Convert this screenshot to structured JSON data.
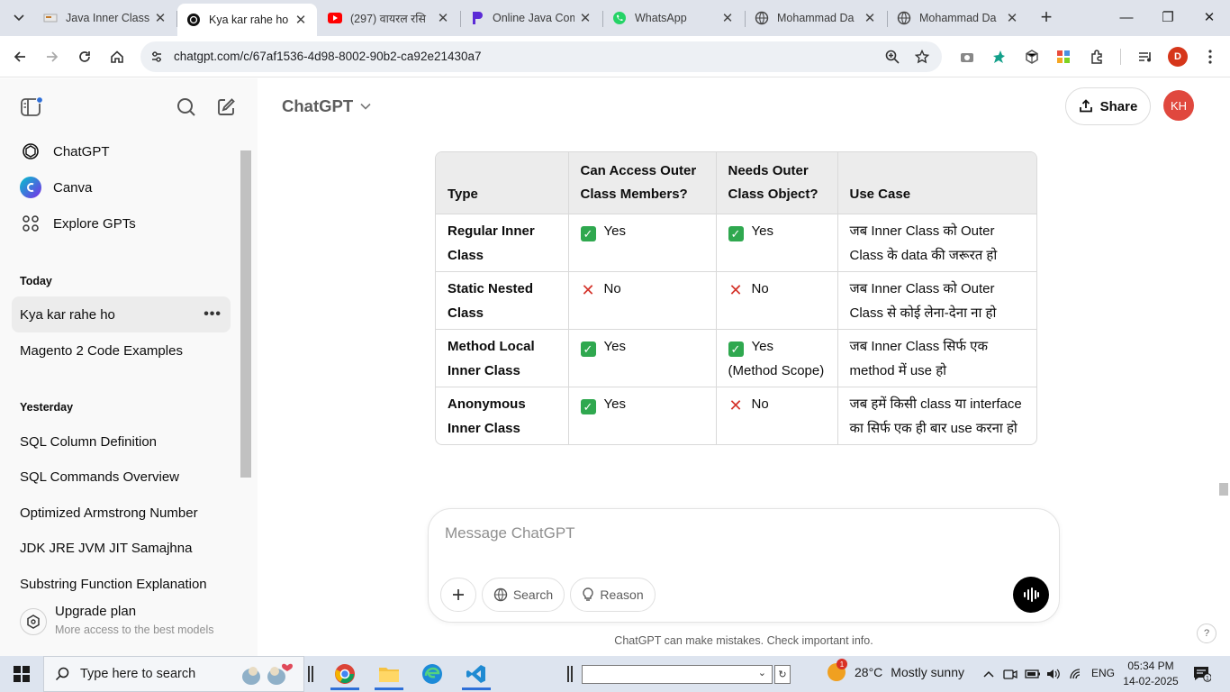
{
  "browser": {
    "tabs": [
      {
        "title": "Java Inner Class |",
        "favicon": "article-icon"
      },
      {
        "title": "Kya kar rahe ho",
        "favicon": "chatgpt-icon",
        "active": true
      },
      {
        "title": "(297) वायरल रसि",
        "favicon": "youtube-icon"
      },
      {
        "title": "Online Java Com",
        "favicon": "compiler-icon"
      },
      {
        "title": "WhatsApp",
        "favicon": "whatsapp-icon"
      },
      {
        "title": "Mohammad Da",
        "favicon": "globe-icon"
      },
      {
        "title": "Mohammad Da",
        "favicon": "globe-icon"
      }
    ],
    "url": "chatgpt.com/c/67af1536-4d98-8002-90b2-ca92e21430a7",
    "profile_initial": "D"
  },
  "sidebar": {
    "top_items": [
      {
        "label": "ChatGPT",
        "icon": "chatgpt-logo-icon"
      },
      {
        "label": "Canva",
        "icon": "canva-icon"
      },
      {
        "label": "Explore GPTs",
        "icon": "grid-icon"
      }
    ],
    "sections": [
      {
        "heading": "Today",
        "items": [
          "Kya kar rahe ho",
          "Magento 2 Code Examples"
        ]
      },
      {
        "heading": "Yesterday",
        "items": [
          "SQL Column Definition",
          "SQL Commands Overview",
          "Optimized Armstrong Number",
          "JDK JRE JVM JIT Samajhna",
          "Substring Function Explanation"
        ]
      }
    ],
    "more_label": "•••",
    "upgrade": {
      "title": "Upgrade plan",
      "subtitle": "More access to the best models"
    }
  },
  "header": {
    "model": "ChatGPT",
    "share_label": "Share",
    "avatar_initials": "KH"
  },
  "table": {
    "headers": [
      "Type",
      "Can Access Outer Class Members?",
      "Needs Outer Class Object?",
      "Use Case"
    ],
    "rows": [
      {
        "type": "Regular Inner Class",
        "access": {
          "mark": "✓",
          "text": "Yes"
        },
        "needs": {
          "mark": "✓",
          "text": "Yes"
        },
        "use_case": "जब Inner Class को Outer Class के data की जरूरत हो"
      },
      {
        "type": "Static Nested Class",
        "access": {
          "mark": "✕",
          "text": "No"
        },
        "needs": {
          "mark": "✕",
          "text": "No"
        },
        "use_case": "जब Inner Class को Outer Class से कोई लेना-देना ना हो"
      },
      {
        "type": "Method Local Inner Class",
        "access": {
          "mark": "✓",
          "text": "Yes"
        },
        "needs": {
          "mark": "✓",
          "text": "Yes (Method Scope)"
        },
        "use_case": "जब Inner Class सिर्फ एक method में use हो"
      },
      {
        "type": "Anonymous Inner Class",
        "access": {
          "mark": "✓",
          "text": "Yes"
        },
        "needs": {
          "mark": "✕",
          "text": "No"
        },
        "use_case": "जब हमें किसी class या interface का सिर्फ एक ही बार use करना हो"
      }
    ]
  },
  "composer": {
    "placeholder": "Message ChatGPT",
    "search_label": "Search",
    "reason_label": "Reason"
  },
  "disclaimer": "ChatGPT can make mistakes. Check important info.",
  "help_label": "?",
  "taskbar": {
    "search_placeholder": "Type here to search",
    "weather": {
      "temp": "28°C",
      "condition": "Mostly sunny",
      "badge": "1"
    },
    "language": "ENG",
    "time": "05:34 PM",
    "date": "14-02-2025"
  },
  "colors": {
    "accent_blue": "#2e6fd8",
    "avatar_red": "#e0483e",
    "yes_green": "#2fa84f",
    "no_red": "#d4332a"
  }
}
